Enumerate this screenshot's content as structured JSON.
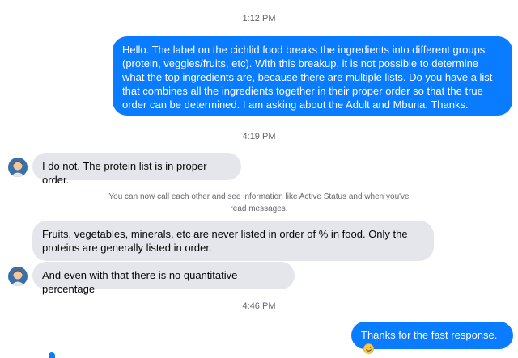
{
  "conversation": {
    "time_1": "1:12 PM",
    "msg_outgoing_1": "Hello.  The label on the cichlid food breaks the ingredients into different groups (protein, veggies/fruits, etc).  With this breakup, it is not possible to determine what the top ingredients are, because there are multiple lists.  Do you have a list that combines all the ingredients together in their proper order so that the true order can be determined.  I am asking about the Adult and Mbuna.  Thanks.",
    "time_2": "4:19 PM",
    "msg_incoming_1": "I do not. The protein list is in proper order.",
    "notice": "You can now call each other and see information like Active Status and when you've read messages.",
    "msg_incoming_2": "Fruits, vegetables,  minerals,  etc are never listed in order of % in food. Only the proteins are generally listed in order.",
    "msg_incoming_3": "And even with that there is no quantitative percentage",
    "time_3": "4:46 PM",
    "msg_outgoing_2": "Thanks for the fast response.",
    "emoji": "smiling-face-emoji"
  },
  "colors": {
    "outgoing_bubble": "#0a7cff",
    "incoming_bubble": "#e4e6eb",
    "timestamp_text": "#65676b"
  }
}
